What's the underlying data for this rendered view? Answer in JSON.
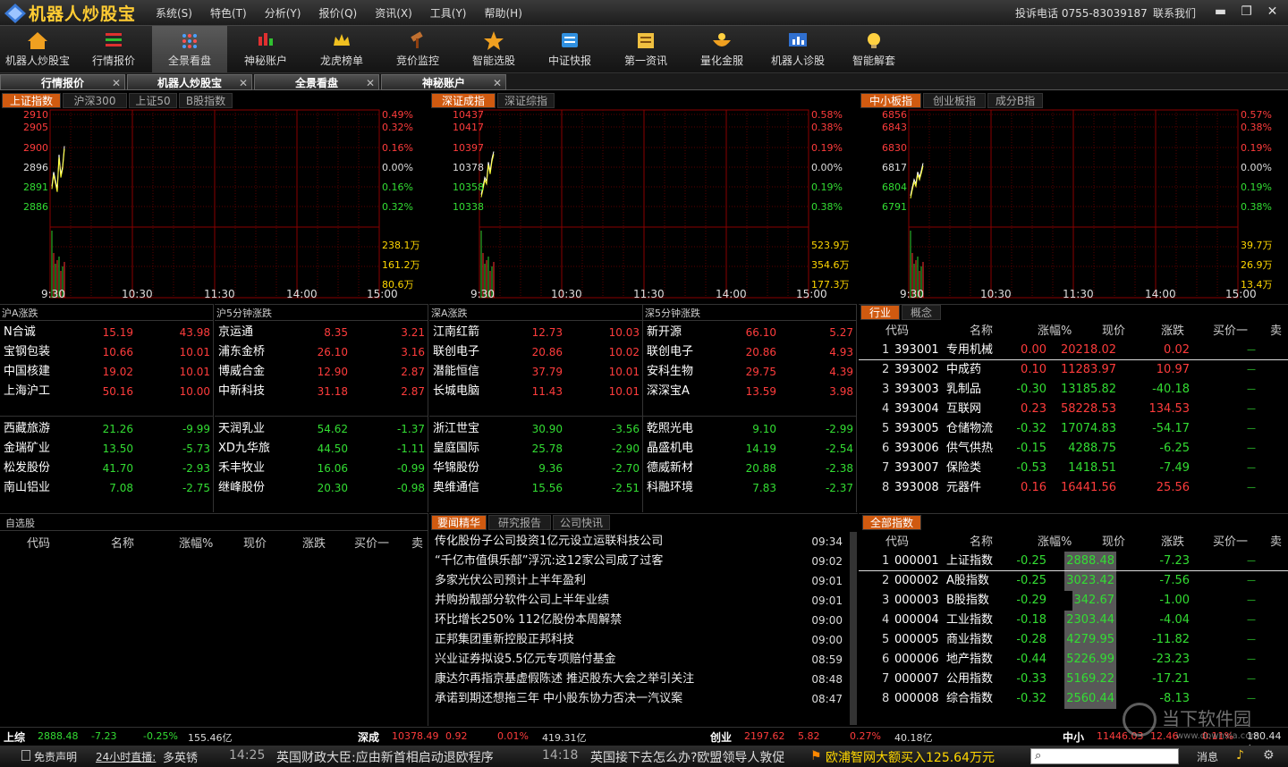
{
  "app": {
    "name": "机器人炒股宝",
    "hotline": "投诉电话 0755-83039187",
    "contact": "联系我们"
  },
  "menu": [
    "系统(S)",
    "特色(T)",
    "分析(Y)",
    "报价(Q)",
    "资讯(X)",
    "工具(Y)",
    "帮助(H)"
  ],
  "toolbar": [
    {
      "label": "机器人炒股宝",
      "icon": "house-icon"
    },
    {
      "label": "行情报价",
      "icon": "list-icon"
    },
    {
      "label": "全景看盘",
      "icon": "dots-grid-icon",
      "active": true
    },
    {
      "label": "神秘账户",
      "icon": "candlestick-icon"
    },
    {
      "label": "龙虎榜单",
      "icon": "crown-icon"
    },
    {
      "label": "竞价监控",
      "icon": "gavel-icon"
    },
    {
      "label": "智能选股",
      "icon": "star-icon"
    },
    {
      "label": "中证快报",
      "icon": "book-icon"
    },
    {
      "label": "第一资讯",
      "icon": "newspaper-icon"
    },
    {
      "label": "量化金服",
      "icon": "coin-bowl-icon"
    },
    {
      "label": "机器人诊股",
      "icon": "monitor-chart-icon"
    },
    {
      "label": "智能解套",
      "icon": "lightbulb-icon"
    }
  ],
  "doc_tabs": [
    "行情报价",
    "机器人炒股宝",
    "全景看盘",
    "神秘账户"
  ],
  "charts": [
    {
      "tabs": [
        "上证指数",
        "沪深300",
        "上证50",
        "B股指数"
      ],
      "prices": [
        "2910",
        "2905",
        "2900",
        "2896",
        "2891",
        "2886"
      ],
      "pcts": [
        "0.49%",
        "0.32%",
        "0.16%",
        "0.00%",
        "0.16%",
        "0.32%"
      ],
      "vols": [
        "238.1万",
        "161.2万",
        "80.6万"
      ],
      "times": [
        "9:30",
        "10:30",
        "11:30",
        "14:00",
        "15:00"
      ]
    },
    {
      "tabs": [
        "深证成指",
        "深证综指"
      ],
      "prices": [
        "10437",
        "10417",
        "10397",
        "10378",
        "10358",
        "10338"
      ],
      "pcts": [
        "0.58%",
        "0.38%",
        "0.19%",
        "0.00%",
        "0.19%",
        "0.38%"
      ],
      "vols": [
        "523.9万",
        "354.6万",
        "177.3万"
      ],
      "times": [
        "9:30",
        "10:30",
        "11:30",
        "14:00",
        "15:00"
      ]
    },
    {
      "tabs": [
        "中小板指",
        "创业板指",
        "成分B指"
      ],
      "prices": [
        "6856",
        "6843",
        "6830",
        "6817",
        "6804",
        "6791"
      ],
      "pcts": [
        "0.57%",
        "0.38%",
        "0.19%",
        "0.00%",
        "0.19%",
        "0.38%"
      ],
      "vols": [
        "39.7万",
        "26.9万",
        "13.4万"
      ],
      "times": [
        "9:30",
        "10:30",
        "11:30",
        "14:00",
        "15:00"
      ]
    }
  ],
  "chart_data": [
    {
      "type": "line",
      "title": "上证指数",
      "x": [
        "9:30",
        "9:33",
        "9:36",
        "9:39",
        "9:42",
        "9:45",
        "9:48",
        "9:51"
      ],
      "y": [
        2888,
        2893,
        2890,
        2887,
        2899,
        2892,
        2895,
        2902
      ],
      "ylim": [
        2881,
        2913
      ]
    },
    {
      "type": "line",
      "title": "深证成指",
      "x": [
        "9:30",
        "9:33",
        "9:36",
        "9:39",
        "9:42",
        "9:45",
        "9:48",
        "9:51"
      ],
      "y": [
        10336,
        10348,
        10362,
        10356,
        10385,
        10371,
        10390,
        10401
      ],
      "ylim": [
        10318,
        10457
      ]
    },
    {
      "type": "line",
      "title": "中小板指",
      "x": [
        "9:30",
        "9:33",
        "9:36",
        "9:39",
        "9:42",
        "9:45",
        "9:48",
        "9:51"
      ],
      "y": [
        6791,
        6799,
        6806,
        6802,
        6813,
        6808,
        6814,
        6821
      ],
      "ylim": [
        6781,
        6866
      ]
    }
  ],
  "rank": [
    {
      "title": "沪A涨跌",
      "up": [
        [
          "N合诚",
          "15.19",
          "43.98"
        ],
        [
          "宝钢包装",
          "10.66",
          "10.01"
        ],
        [
          "中国核建",
          "19.02",
          "10.01"
        ],
        [
          "上海沪工",
          "50.16",
          "10.00"
        ]
      ],
      "down": [
        [
          "西藏旅游",
          "21.26",
          "-9.99"
        ],
        [
          "金瑞矿业",
          "13.50",
          "-5.73"
        ],
        [
          "松发股份",
          "41.70",
          "-2.93"
        ],
        [
          "南山铝业",
          "7.08",
          "-2.75"
        ]
      ]
    },
    {
      "title": "沪5分钟涨跌",
      "up": [
        [
          "京运通",
          "8.35",
          "3.21"
        ],
        [
          "浦东金桥",
          "26.10",
          "3.16"
        ],
        [
          "博威合金",
          "12.90",
          "2.87"
        ],
        [
          "中新科技",
          "31.18",
          "2.87"
        ]
      ],
      "down": [
        [
          "天润乳业",
          "54.62",
          "-1.37"
        ],
        [
          "XD九华旅",
          "44.50",
          "-1.11"
        ],
        [
          "禾丰牧业",
          "16.06",
          "-0.99"
        ],
        [
          "继峰股份",
          "20.30",
          "-0.98"
        ]
      ]
    },
    {
      "title": "深A涨跌",
      "up": [
        [
          "江南红箭",
          "12.73",
          "10.03"
        ],
        [
          "联创电子",
          "20.86",
          "10.02"
        ],
        [
          "潜能恒信",
          "37.79",
          "10.01"
        ],
        [
          "长城电脑",
          "11.43",
          "10.01"
        ]
      ],
      "down": [
        [
          "浙江世宝",
          "30.90",
          "-3.56"
        ],
        [
          "皇庭国际",
          "25.78",
          "-2.90"
        ],
        [
          "华锦股份",
          "9.36",
          "-2.70"
        ],
        [
          "奥维通信",
          "15.56",
          "-2.51"
        ]
      ]
    },
    {
      "title": "深5分钟涨跌",
      "up": [
        [
          "新开源",
          "66.10",
          "5.27"
        ],
        [
          "联创电子",
          "20.86",
          "4.93"
        ],
        [
          "安科生物",
          "29.75",
          "4.39"
        ],
        [
          "深深宝A",
          "13.59",
          "3.98"
        ]
      ],
      "down": [
        [
          "乾照光电",
          "9.10",
          "-2.99"
        ],
        [
          "晶盛机电",
          "14.19",
          "-2.54"
        ],
        [
          "德威新材",
          "20.88",
          "-2.38"
        ],
        [
          "科融环境",
          "7.83",
          "-2.37"
        ]
      ]
    }
  ],
  "industry": {
    "tabs": [
      "行业",
      "概念"
    ],
    "headers": [
      "代码",
      "名称",
      "涨幅%",
      "现价",
      "涨跌",
      "买价一",
      "卖"
    ],
    "rows": [
      [
        "1",
        "393001",
        "专用机械",
        "0.00",
        "20218.02",
        "0.02",
        "—"
      ],
      [
        "2",
        "393002",
        "中成药",
        "0.10",
        "11283.97",
        "10.97",
        "—"
      ],
      [
        "3",
        "393003",
        "乳制品",
        "-0.30",
        "13185.82",
        "-40.18",
        "—"
      ],
      [
        "4",
        "393004",
        "互联网",
        "0.23",
        "58228.53",
        "134.53",
        "—"
      ],
      [
        "5",
        "393005",
        "仓储物流",
        "-0.32",
        "17074.83",
        "-54.17",
        "—"
      ],
      [
        "6",
        "393006",
        "供气供热",
        "-0.15",
        "4288.75",
        "-6.25",
        "—"
      ],
      [
        "7",
        "393007",
        "保险类",
        "-0.53",
        "1418.51",
        "-7.49",
        "—"
      ],
      [
        "8",
        "393008",
        "元器件",
        "0.16",
        "16441.56",
        "25.56",
        "—"
      ]
    ]
  },
  "watchlist": {
    "title": "自选股",
    "headers": [
      "代码",
      "名称",
      "涨幅%",
      "现价",
      "涨跌",
      "买价一",
      "卖"
    ]
  },
  "news": {
    "tabs": [
      "要闻精华",
      "研究报告",
      "公司快讯"
    ],
    "items": [
      [
        "传化股份子公司投资1亿元设立运联科技公司",
        "09:34"
      ],
      [
        "“千亿市值俱乐部”浮沉:这12家公司成了过客",
        "09:02"
      ],
      [
        "多家光伏公司预计上半年盈利",
        "09:01"
      ],
      [
        "并购扮靓部分软件公司上半年业绩",
        "09:01"
      ],
      [
        "环比增长250% 112亿股份本周解禁",
        "09:00"
      ],
      [
        "正邦集团重新控股正邦科技",
        "09:00"
      ],
      [
        "兴业证券拟设5.5亿元专项赔付基金",
        "08:59"
      ],
      [
        "康达尔再指京基虚假陈述 推迟股东大会之举引关注",
        "08:48"
      ],
      [
        "承诺到期还想拖三年 中小股东协力否决一汽议案",
        "08:47"
      ]
    ]
  },
  "indices": {
    "tab": "全部指数",
    "headers": [
      "代码",
      "名称",
      "涨幅%",
      "现价",
      "涨跌",
      "买价一",
      "卖"
    ],
    "rows": [
      [
        "1",
        "000001",
        "上证指数",
        "-0.25",
        "2888.48",
        "-7.23",
        "—"
      ],
      [
        "2",
        "000002",
        "A股指数",
        "-0.25",
        "3023.42",
        "-7.56",
        "—"
      ],
      [
        "3",
        "000003",
        "B股指数",
        "-0.29",
        "342.67",
        "-1.00",
        "—"
      ],
      [
        "4",
        "000004",
        "工业指数",
        "-0.18",
        "2303.44",
        "-4.04",
        "—"
      ],
      [
        "5",
        "000005",
        "商业指数",
        "-0.28",
        "4279.95",
        "-11.82",
        "—"
      ],
      [
        "6",
        "000006",
        "地产指数",
        "-0.44",
        "5226.99",
        "-23.23",
        "—"
      ],
      [
        "7",
        "000007",
        "公用指数",
        "-0.33",
        "5169.22",
        "-17.21",
        "—"
      ],
      [
        "8",
        "000008",
        "综合指数",
        "-0.32",
        "2560.44",
        "-8.13",
        "—"
      ]
    ]
  },
  "status": [
    {
      "name": "上综",
      "price": "2888.48",
      "chg": "-7.23",
      "pct": "-0.25%",
      "vol": "155.46亿"
    },
    {
      "name": "深成",
      "price": "10378.49",
      "chg": "0.92",
      "pct": "0.01%",
      "vol": "419.31亿"
    },
    {
      "name": "创业",
      "price": "2197.62",
      "chg": "5.82",
      "pct": "0.27%",
      "vol": "40.18亿"
    },
    {
      "name": "中小",
      "price": "11446.03",
      "chg": "12.46",
      "pct": "0.11%",
      "vol": "180.44亿"
    }
  ],
  "ticker": {
    "disclaimer": "免责声明",
    "live": "24小时直播:",
    "live_host": "多英锈",
    "items": [
      [
        "14:25",
        "英国财政大臣:应由新首相启动退欧程序"
      ],
      [
        "14:18",
        "英国接下去怎么办?欧盟领导人敦促"
      ]
    ],
    "alert": "欧浦智网大额买入125.64万元",
    "msg": "消息"
  },
  "watermark": {
    "name": "当下软件园",
    "url": "www.downxia.com"
  }
}
